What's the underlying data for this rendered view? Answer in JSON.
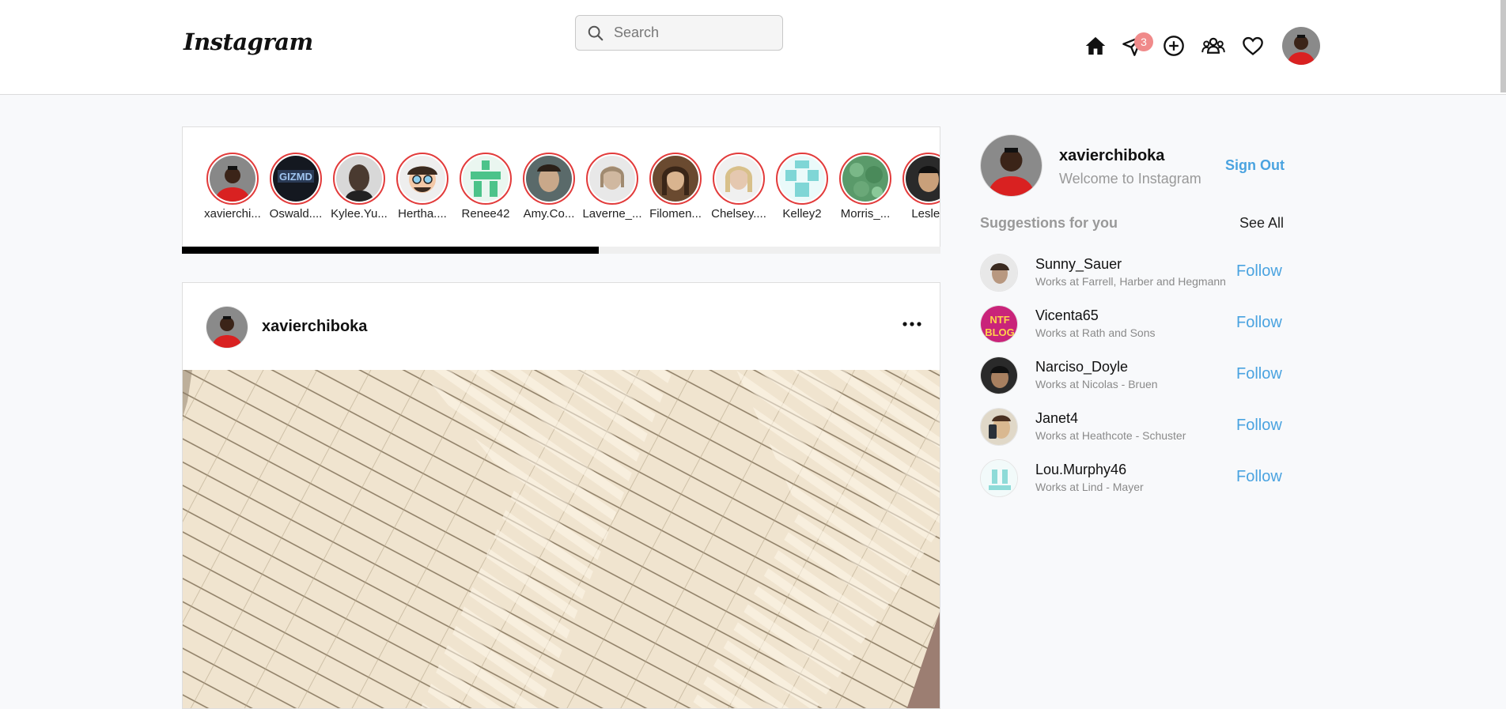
{
  "header": {
    "logo": "Instagram",
    "search_placeholder": "Search",
    "messages_badge": "3",
    "icons": [
      "home-icon",
      "send-icon",
      "add-post-icon",
      "people-icon",
      "heart-icon"
    ]
  },
  "stories": {
    "progress_percent": 55,
    "items": [
      {
        "username": "xavierchi..."
      },
      {
        "username": "Oswald...."
      },
      {
        "username": "Kylee.Yu..."
      },
      {
        "username": "Hertha...."
      },
      {
        "username": "Renee42"
      },
      {
        "username": "Amy.Co..."
      },
      {
        "username": "Laverne_..."
      },
      {
        "username": "Filomen..."
      },
      {
        "username": "Chelsey...."
      },
      {
        "username": "Kelley2"
      },
      {
        "username": "Morris_..."
      },
      {
        "username": "Lesley"
      }
    ]
  },
  "post": {
    "username": "xavierchiboka"
  },
  "sidebar": {
    "username": "xavierchiboka",
    "subtitle": "Welcome to Instagram",
    "sign_out": "Sign Out",
    "suggestions_title": "Suggestions for you",
    "see_all": "See All",
    "follow_label": "Follow",
    "suggestions": [
      {
        "username": "Sunny_Sauer",
        "work": "Works at Farrell, Harber and Hegmann"
      },
      {
        "username": "Vicenta65",
        "work": "Works at Rath and Sons"
      },
      {
        "username": "Narciso_Doyle",
        "work": "Works at Nicolas - Bruen"
      },
      {
        "username": "Janet4",
        "work": "Works at Heathcote - Schuster"
      },
      {
        "username": "Lou.Murphy46",
        "work": "Works at Lind - Mayer"
      }
    ]
  },
  "colors": {
    "accent": "#4aa3e0",
    "story_ring": "#e23b3b",
    "badge": "#f08a8a"
  }
}
